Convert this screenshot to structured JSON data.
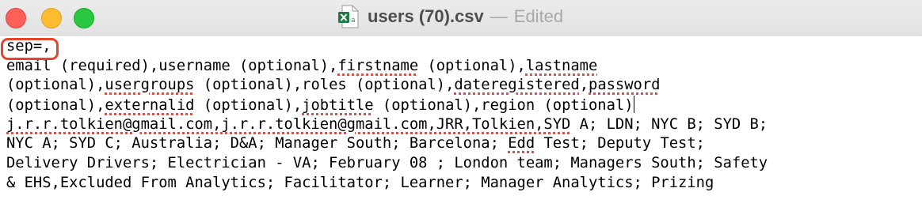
{
  "window": {
    "file_name": "users (70).csv",
    "separator": "—",
    "status": "Edited",
    "icon": "excel-csv-file-icon",
    "file_icon_letter": "a",
    "colors": {
      "close": "#fe5f57",
      "minimize": "#febc2e",
      "maximize": "#28c840",
      "annotation": "#e8442c",
      "spellcheck": "#e74c3c"
    }
  },
  "editor": {
    "lines": [
      {
        "segments": [
          {
            "text": "sep=,",
            "spell": false
          }
        ]
      },
      {
        "segments": [
          {
            "text": "email (required),username (optional),",
            "spell": false
          },
          {
            "text": "firstname",
            "spell": true
          },
          {
            "text": " (optional),",
            "spell": false
          },
          {
            "text": "lastname",
            "spell": true
          }
        ]
      },
      {
        "segments": [
          {
            "text": "(optional),",
            "spell": false
          },
          {
            "text": "usergroups",
            "spell": true
          },
          {
            "text": " (optional),roles (optional),",
            "spell": false
          },
          {
            "text": "dateregistered",
            "spell": true
          },
          {
            "text": ",",
            "spell": false
          },
          {
            "text": "password",
            "spell": true
          }
        ]
      },
      {
        "segments": [
          {
            "text": "(optional),",
            "spell": false
          },
          {
            "text": "externalid",
            "spell": true
          },
          {
            "text": " (optional),",
            "spell": false
          },
          {
            "text": "jobtitle",
            "spell": true
          },
          {
            "text": " (optional),region (optional)",
            "spell": false
          }
        ],
        "caret": true
      },
      {
        "segments": [
          {
            "text": "j.r.r.tolkien@gmail.com,j.r.r.tolkien@gmail.com,JRR,Tolkien,SYD",
            "spell": true
          },
          {
            "text": " A; LDN; NYC B; SYD B;",
            "spell": false
          }
        ]
      },
      {
        "segments": [
          {
            "text": "NYC A; SYD C; Australia; D&A; Manager South; Barcelona; ",
            "spell": false
          },
          {
            "text": "Edd",
            "spell": true
          },
          {
            "text": " Test; Deputy Test;",
            "spell": false
          }
        ]
      },
      {
        "segments": [
          {
            "text": "Delivery Drivers; Electrician - VA; February 08 ; London team; Managers South; Safety",
            "spell": false
          }
        ]
      },
      {
        "segments": [
          {
            "text": "& EHS,Excluded From Analytics; Facilitator; Learner; Manager Analytics; Prizing",
            "spell": false
          }
        ]
      }
    ]
  }
}
